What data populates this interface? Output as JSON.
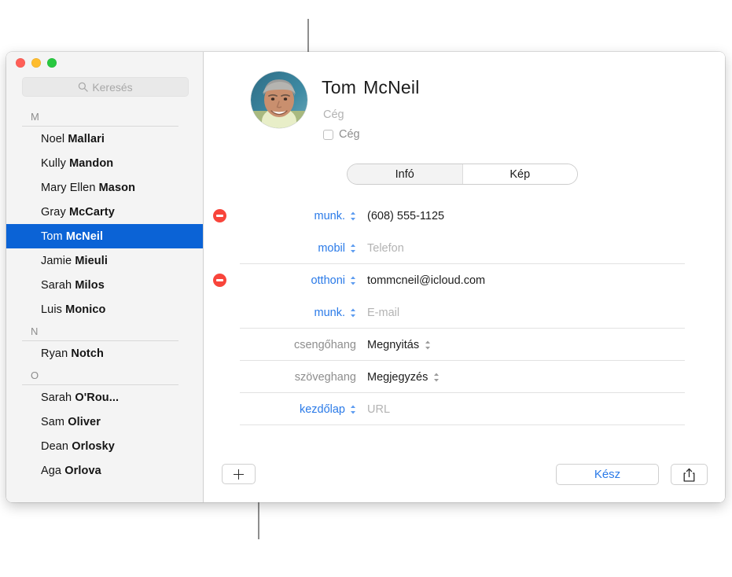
{
  "window": {
    "traffic_lights": [
      {
        "name": "close",
        "color": "#ff5f57"
      },
      {
        "name": "minimize",
        "color": "#febc2e"
      },
      {
        "name": "zoom",
        "color": "#28c840"
      }
    ]
  },
  "sidebar": {
    "search": {
      "placeholder": "Keresés",
      "icon": "search-icon"
    },
    "sections": [
      {
        "letter": "M",
        "contacts": [
          {
            "given": "Noel",
            "family": "Mallari",
            "selected": false
          },
          {
            "given": "Kully",
            "family": "Mandon",
            "selected": false
          },
          {
            "given": "Mary Ellen",
            "family": "Mason",
            "selected": false
          },
          {
            "given": "Gray",
            "family": "McCarty",
            "selected": false
          },
          {
            "given": "Tom",
            "family": "McNeil",
            "selected": true
          },
          {
            "given": "Jamie",
            "family": "Mieuli",
            "selected": false
          },
          {
            "given": "Sarah",
            "family": "Milos",
            "selected": false
          },
          {
            "given": "Luis",
            "family": "Monico",
            "selected": false
          }
        ]
      },
      {
        "letter": "N",
        "contacts": [
          {
            "given": "Ryan",
            "family": "Notch",
            "selected": false
          }
        ]
      },
      {
        "letter": "O",
        "contacts": [
          {
            "given": "Sarah",
            "family": "O'Rou...",
            "selected": false
          },
          {
            "given": "Sam",
            "family": "Oliver",
            "selected": false
          },
          {
            "given": "Dean",
            "family": "Orlosky",
            "selected": false
          },
          {
            "given": "Aga",
            "family": "Orlova",
            "selected": false
          }
        ]
      }
    ]
  },
  "detail": {
    "avatar_icon": "contact-photo",
    "name": {
      "given": "Tom",
      "family": "McNeil"
    },
    "company_placeholder": "Cég",
    "company_checkbox_label": "Cég",
    "tabs": [
      {
        "label": "Infó",
        "active": true
      },
      {
        "label": "Kép",
        "active": false
      }
    ],
    "fields": [
      {
        "removable": true,
        "label": "munk.",
        "label_style": "link",
        "has_stepper": true,
        "value": "(608) 555-1125",
        "is_placeholder": false,
        "value_stepper": false,
        "sep_top": false,
        "sep_bottom": false
      },
      {
        "removable": false,
        "label": "mobil",
        "label_style": "link",
        "has_stepper": true,
        "value": "Telefon",
        "is_placeholder": true,
        "value_stepper": false,
        "sep_top": false,
        "sep_bottom": true
      },
      {
        "removable": true,
        "label": "otthoni",
        "label_style": "link",
        "has_stepper": true,
        "value": "tommcneil@icloud.com",
        "is_placeholder": false,
        "value_stepper": false,
        "sep_top": false,
        "sep_bottom": false
      },
      {
        "removable": false,
        "label": "munk.",
        "label_style": "link",
        "has_stepper": true,
        "value": "E-mail",
        "is_placeholder": true,
        "value_stepper": false,
        "sep_top": false,
        "sep_bottom": true
      },
      {
        "removable": false,
        "label": "csengőhang",
        "label_style": "muted",
        "has_stepper": false,
        "value": "Megnyitás",
        "is_placeholder": false,
        "value_stepper": true,
        "sep_top": false,
        "sep_bottom": true
      },
      {
        "removable": false,
        "label": "szöveghang",
        "label_style": "muted",
        "has_stepper": false,
        "value": "Megjegyzés",
        "is_placeholder": false,
        "value_stepper": true,
        "sep_top": false,
        "sep_bottom": true
      },
      {
        "removable": false,
        "label": "kezdőlap",
        "label_style": "link",
        "has_stepper": true,
        "value": "URL",
        "is_placeholder": true,
        "value_stepper": false,
        "sep_top": false,
        "sep_bottom": true
      }
    ],
    "bottom_bar": {
      "add_icon": "plus-icon",
      "done_label": "Kész",
      "share_icon": "share-icon"
    }
  },
  "colors": {
    "selection_blue": "#0b63d6",
    "link_blue": "#2a7ae8",
    "remove_red": "#f8453b",
    "sidebar_bg": "#f4f4f4",
    "callout_gray": "#8e8e8e"
  }
}
